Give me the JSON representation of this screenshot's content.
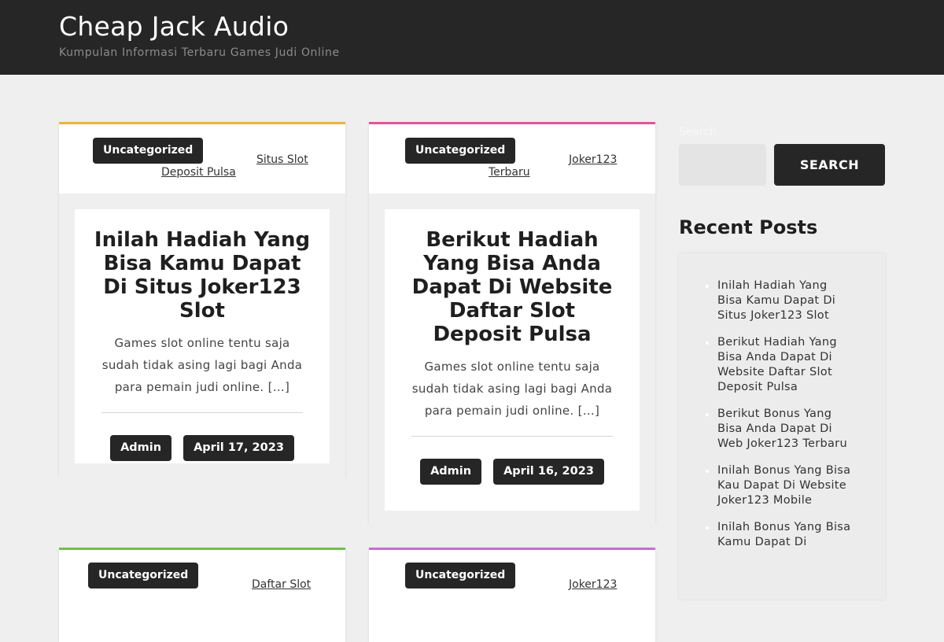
{
  "header": {
    "title": "Cheap Jack Audio",
    "tagline": "Kumpulan Informasi Terbaru Games Judi Online"
  },
  "posts": [
    {
      "accent": "#f0b43c",
      "category": "Uncategorized",
      "tag_lines": [
        "Situs Slot",
        "Deposit Pulsa"
      ],
      "title": "Inilah Hadiah Yang Bisa Kamu Dapat Di Situs Joker123 Slot",
      "excerpt": "Games slot online tentu saja sudah tidak asing lagi bagi Anda para pemain judi online. […]",
      "author": "Admin",
      "date": "April 17, 2023"
    },
    {
      "accent": "#e0559a",
      "category": "Uncategorized",
      "tag_lines": [
        "Joker123",
        "Terbaru"
      ],
      "title": "Berikut Hadiah Yang Bisa Anda Dapat Di Website Daftar Slot Deposit Pulsa",
      "excerpt": "Games slot online tentu saja sudah tidak asing lagi bagi Anda para pemain judi online. […]",
      "author": "Admin",
      "date": "April 16, 2023"
    },
    {
      "accent": "#6ec04a",
      "category": "Uncategorized",
      "tag_lines": [
        "Daftar Slot"
      ]
    },
    {
      "accent": "#c76fd1",
      "category": "Uncategorized",
      "tag_lines": [
        "Joker123"
      ]
    }
  ],
  "sidebar": {
    "search_label": "Search",
    "search_button": "SEARCH",
    "recent_title": "Recent Posts",
    "recent_posts": [
      "Inilah Hadiah Yang Bisa Kamu Dapat Di Situs Joker123 Slot",
      "Berikut Hadiah Yang Bisa Anda Dapat Di Website Daftar Slot Deposit Pulsa",
      "Berikut Bonus Yang Bisa Anda Dapat Di Web Joker123 Terbaru",
      "Inilah Bonus Yang Bisa Kau Dapat Di Website Joker123 Mobile",
      "Inilah Bonus Yang Bisa Kamu Dapat Di"
    ]
  }
}
